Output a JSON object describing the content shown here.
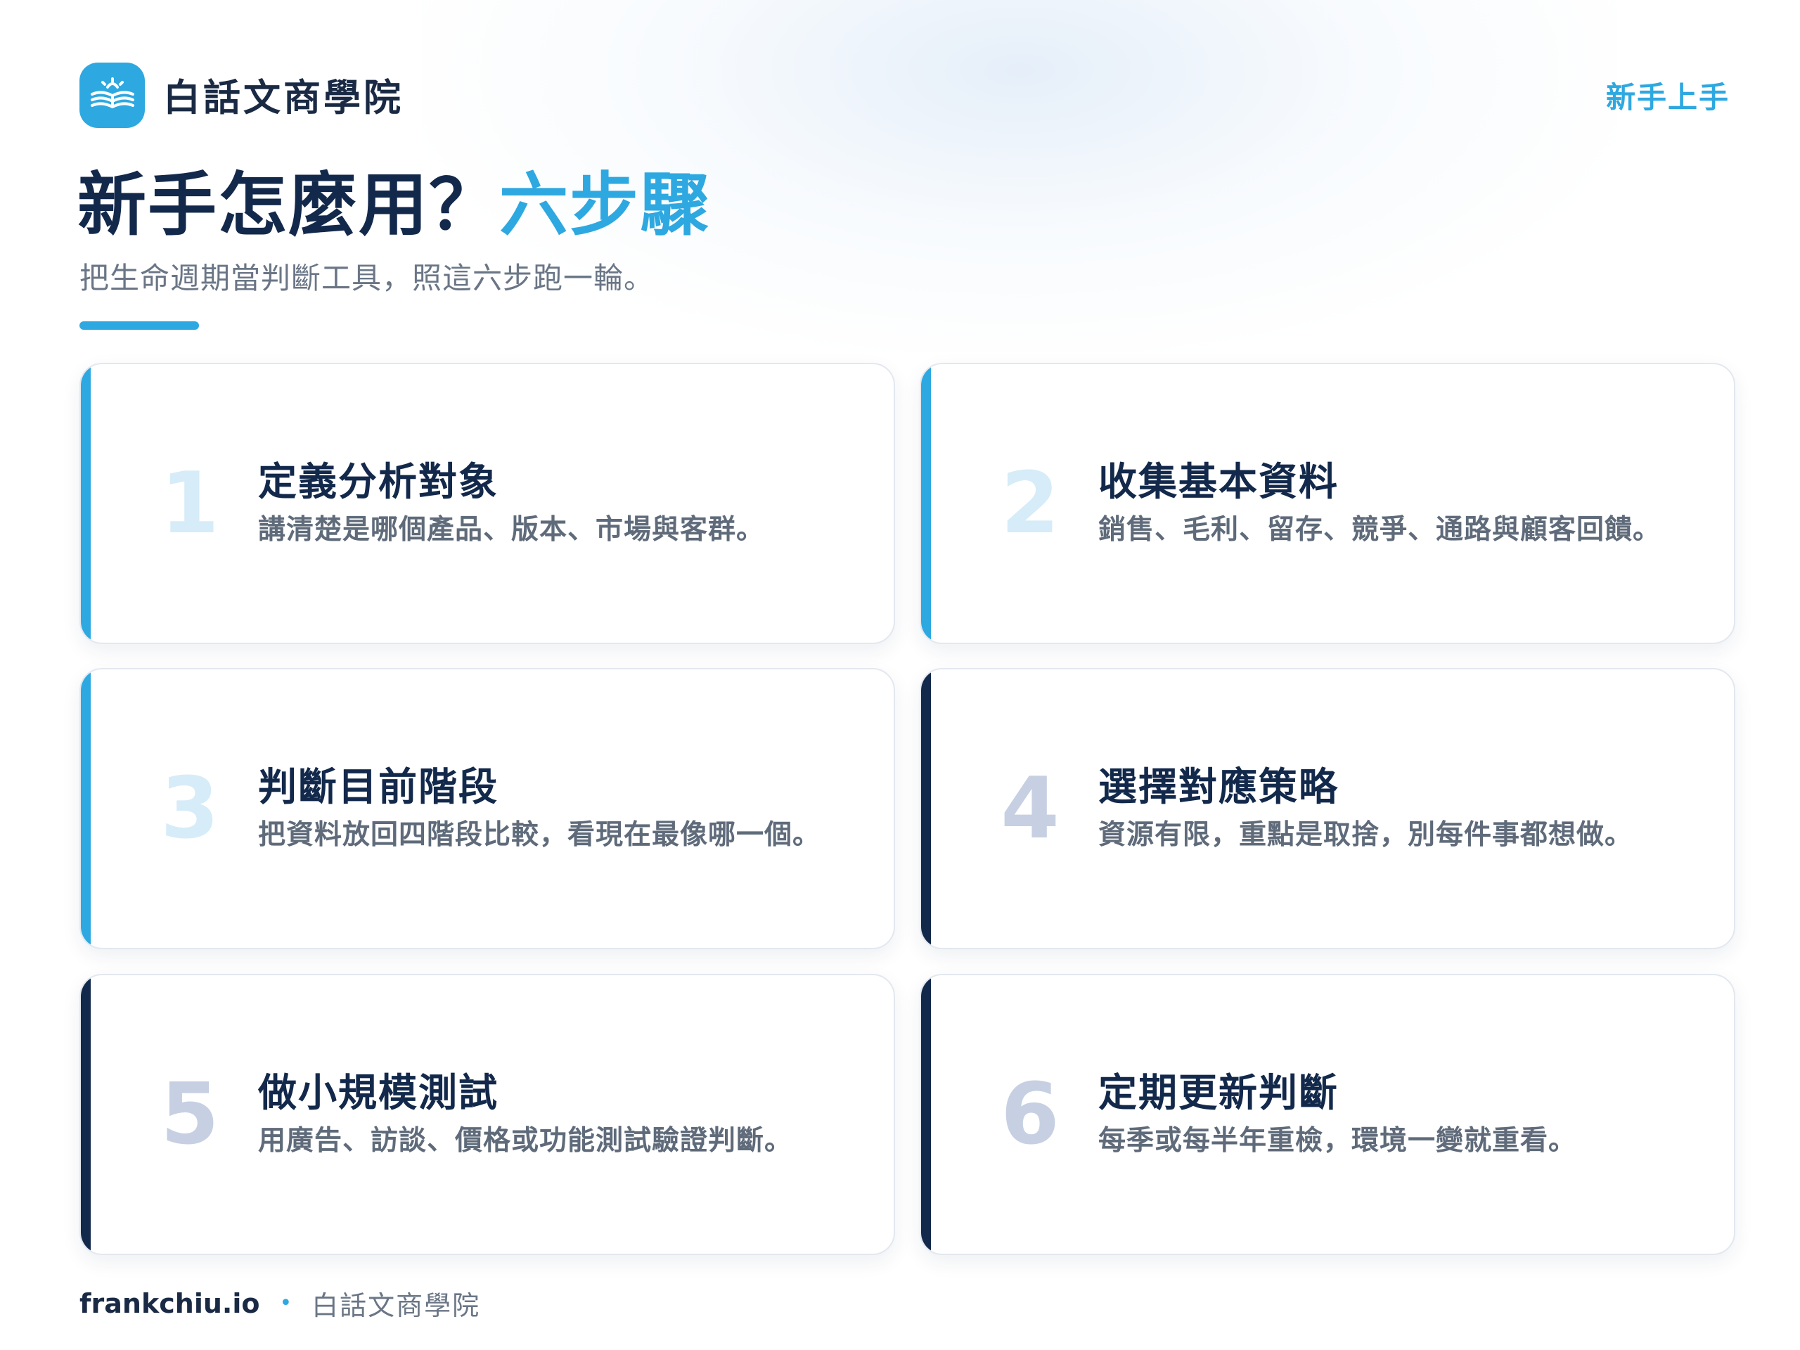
{
  "brand": {
    "name": "白話文商學院"
  },
  "header": {
    "section_tag": "新手上手"
  },
  "title": {
    "main": "新手怎麼用？",
    "highlight": "六步驟"
  },
  "subtitle": "把生命週期當判斷工具，照這六步跑一輪。",
  "steps": [
    {
      "number": "1",
      "title": "定義分析對象",
      "desc": "講清楚是哪個產品、版本、市場與客群。"
    },
    {
      "number": "2",
      "title": "收集基本資料",
      "desc": "銷售、毛利、留存、競爭、通路與顧客回饋。"
    },
    {
      "number": "3",
      "title": "判斷目前階段",
      "desc": "把資料放回四階段比較，看現在最像哪一個。"
    },
    {
      "number": "4",
      "title": "選擇對應策略",
      "desc": "資源有限，重點是取捨，別每件事都想做。"
    },
    {
      "number": "5",
      "title": "做小規模測試",
      "desc": "用廣告、訪談、價格或功能測試驗證判斷。"
    },
    {
      "number": "6",
      "title": "定期更新判斷",
      "desc": "每季或每半年重檢，環境一變就重看。"
    }
  ],
  "footer": {
    "domain": "frankchiu.io",
    "separator": "•",
    "name": "白話文商學院"
  },
  "colors": {
    "accent": "#2ea8e0",
    "navy": "#13294b",
    "muted": "#6a7686"
  },
  "icons": {
    "logo": "open-book-icon"
  }
}
